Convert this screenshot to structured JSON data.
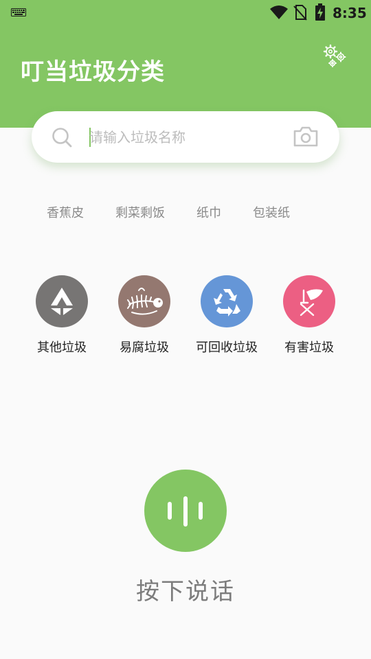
{
  "status_bar": {
    "time": "8:35",
    "icons": [
      "keyboard-icon",
      "wifi-icon",
      "no-sim-icon",
      "battery-charging-icon"
    ]
  },
  "header": {
    "title": "叮当垃圾分类",
    "settings_icon": "gear-icon"
  },
  "search": {
    "placeholder": "请输入垃圾名称",
    "value": "",
    "left_icon": "search-icon",
    "right_icon": "camera-icon"
  },
  "hot_words": [
    "香蕉皮",
    "剩菜剩饭",
    "纸巾",
    "包装纸"
  ],
  "categories": [
    {
      "label": "其他垃圾",
      "icon": "other-waste-icon",
      "color": "#777574"
    },
    {
      "label": "易腐垃圾",
      "icon": "fish-bone-icon",
      "color": "#947870"
    },
    {
      "label": "可回收垃圾",
      "icon": "recycle-icon",
      "color": "#6596d7"
    },
    {
      "label": "有害垃圾",
      "icon": "hazardous-waste-icon",
      "color": "#ec5f83"
    }
  ],
  "voice": {
    "label": "按下说话",
    "icon": "voice-wave-icon"
  },
  "colors": {
    "brand_green": "#84c663",
    "background": "#fafafa",
    "hot_word_text": "#8a8a8a",
    "voice_label_text": "#7c7c7c"
  }
}
